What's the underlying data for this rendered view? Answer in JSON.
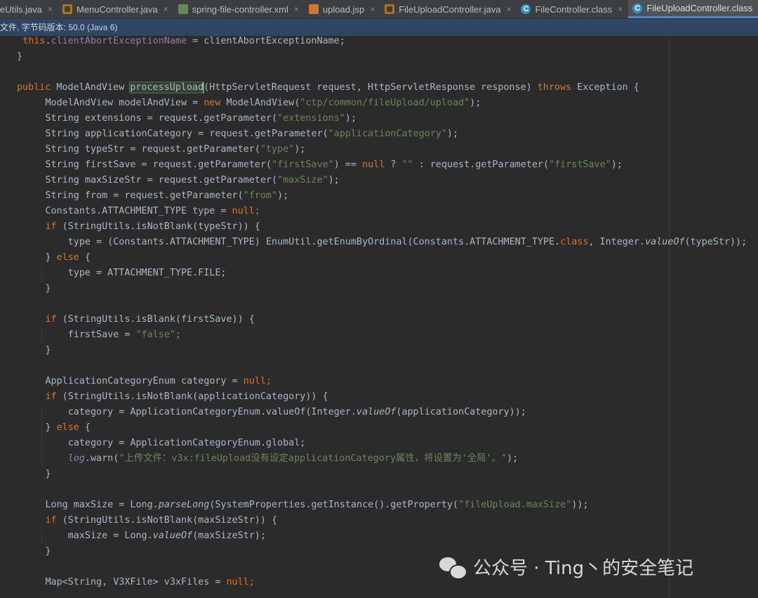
{
  "tabs": [
    {
      "label": "eUtils.java",
      "icon": "java-file-icon"
    },
    {
      "label": "MenuController.java",
      "icon": "java-file-icon"
    },
    {
      "label": "spring-file-controller.xml",
      "icon": "xml-file-icon"
    },
    {
      "label": "upload.jsp",
      "icon": "jsp-file-icon"
    },
    {
      "label": "FileUploadController.java",
      "icon": "java-file-icon"
    },
    {
      "label": "FileController.class",
      "icon": "class-file-icon"
    },
    {
      "label": "FileUploadController.class",
      "icon": "class-file-icon",
      "active": true
    }
  ],
  "tab_close": "×",
  "infobar": {
    "text": "文件, 字节码版本: 50.0 (Java 6)"
  },
  "code": {
    "l1": {
      "a": "    ",
      "b": "this",
      "c": ".",
      "d": "clientAbortExceptionName",
      "e": " = clientAbortExceptionName;"
    },
    "l2": "}",
    "l4": {
      "a": "public",
      "b": " ModelAndView ",
      "c": "processUpload",
      "d": "(HttpServletRequest request, HttpServletResponse response) ",
      "e": "throws",
      "f": " Exception {"
    },
    "l5": {
      "a": "        ModelAndView modelAndView = ",
      "b": "new",
      "c": " ModelAndView(",
      "d": "\"ctp/common/fileUpload/upload\"",
      "e": ");"
    },
    "l6": {
      "a": "        String extensions = request.getParameter(",
      "b": "\"extensions\"",
      "c": ");"
    },
    "l7": {
      "a": "        String applicationCategory = request.getParameter(",
      "b": "\"applicationCategory\"",
      "c": ");"
    },
    "l8": {
      "a": "        String typeStr = request.getParameter(",
      "b": "\"type\"",
      "c": ");"
    },
    "l9": {
      "a": "        String firstSave = request.getParameter(",
      "b": "\"firstSave\"",
      "c": ") == ",
      "d": "null",
      "e": " ? ",
      "f": "\"\"",
      "g": " : request.getParameter(",
      "h": "\"firstSave\"",
      "i": ");"
    },
    "l10": {
      "a": "        String maxSizeStr = request.getParameter(",
      "b": "\"maxSize\"",
      "c": ");"
    },
    "l11": {
      "a": "        String from = request.getParameter(",
      "b": "\"from\"",
      "c": ");"
    },
    "l12": {
      "a": "        Constants.ATTACHMENT_TYPE type = ",
      "b": "null",
      "c": ";"
    },
    "l13": {
      "a": "        ",
      "b": "if",
      "c": " (StringUtils.isNotBlank(typeStr)) {"
    },
    "l14": {
      "a": "            type = (Constants.ATTACHMENT_TYPE) EnumUtil.getEnumByOrdinal(Constants.ATTACHMENT_TYPE.",
      "b": "class",
      "c": ", Integer.",
      "d": "valueOf",
      "e": "(typeStr));"
    },
    "l15": {
      "a": "        } ",
      "b": "else",
      "c": " {"
    },
    "l16": "            type = ATTACHMENT_TYPE.FILE;",
    "l17": "        }",
    "l19": {
      "a": "        ",
      "b": "if",
      "c": " (StringUtils.isBlank(firstSave)) {"
    },
    "l20": {
      "a": "            firstSave = ",
      "b": "\"false\"",
      "c": ";"
    },
    "l21": "        }",
    "l23": {
      "a": "        ApplicationCategoryEnum category = ",
      "b": "null",
      "c": ";"
    },
    "l24": {
      "a": "        ",
      "b": "if",
      "c": " (StringUtils.isNotBlank(applicationCategory)) {"
    },
    "l25": {
      "a": "            category = ApplicationCategoryEnum.valueOf(Integer.",
      "b": "valueOf",
      "c": "(applicationCategory));"
    },
    "l26": {
      "a": "        } ",
      "b": "else",
      "c": " {"
    },
    "l27": {
      "a": "            category = ApplicationCategoryEnum.global;"
    },
    "l28": {
      "a": "            ",
      "b": "log",
      "c": ".warn(",
      "d": "\"上传文件：v3x:fileUpload没有设定applicationCategory属性，将设置为'全局'。\"",
      "e": ");"
    },
    "l29": "        }",
    "l31": {
      "a": "        Long maxSize = Long.",
      "b": "parseLong",
      "c": "(SystemProperties.getInstance().getProperty(",
      "d": "\"fileUpload.maxSize\"",
      "e": "));"
    },
    "l32": {
      "a": "        ",
      "b": "if",
      "c": " (StringUtils.isNotBlank(maxSizeStr)) {"
    },
    "l33": {
      "a": "            maxSize = Long.",
      "b": "valueOf",
      "c": "(maxSizeStr);"
    },
    "l34": "        }",
    "l36": {
      "a": "        Map<String, V3XFile> v3xFiles = ",
      "b": "null",
      "c": ";"
    }
  },
  "watermark": {
    "text": "公众号 · Ting丶的安全笔记",
    "icon": "wechat-icon"
  },
  "colors": {
    "keyword": "#cc7832",
    "string": "#6a8759",
    "field": "#9876aa",
    "text": "#a9b7c6",
    "background": "#2b2b2b"
  }
}
